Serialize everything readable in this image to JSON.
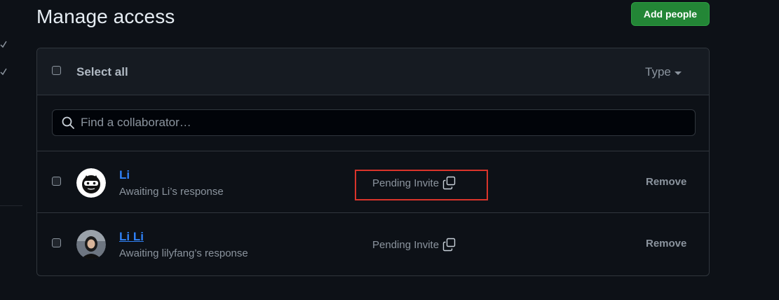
{
  "page": {
    "title": "Manage access",
    "add_button_label": "Add people"
  },
  "header": {
    "select_all_label": "Select all",
    "type_filter_label": "Type"
  },
  "search": {
    "placeholder": "Find a collaborator…",
    "value": ""
  },
  "collaborators": [
    {
      "name": "Li",
      "status": "Awaiting Li’s response",
      "role": "Pending Invite",
      "action": "Remove",
      "avatar": "ninja-avatar-icon"
    },
    {
      "name": "Li Li",
      "status": "Awaiting lilyfang’s response",
      "role": "Pending Invite",
      "action": "Remove",
      "avatar": "user-photo-avatar"
    }
  ],
  "colors": {
    "background": "#0d1117",
    "accent_green": "#238636",
    "link_blue": "#2f81f7",
    "highlight_red": "#d9342b"
  }
}
